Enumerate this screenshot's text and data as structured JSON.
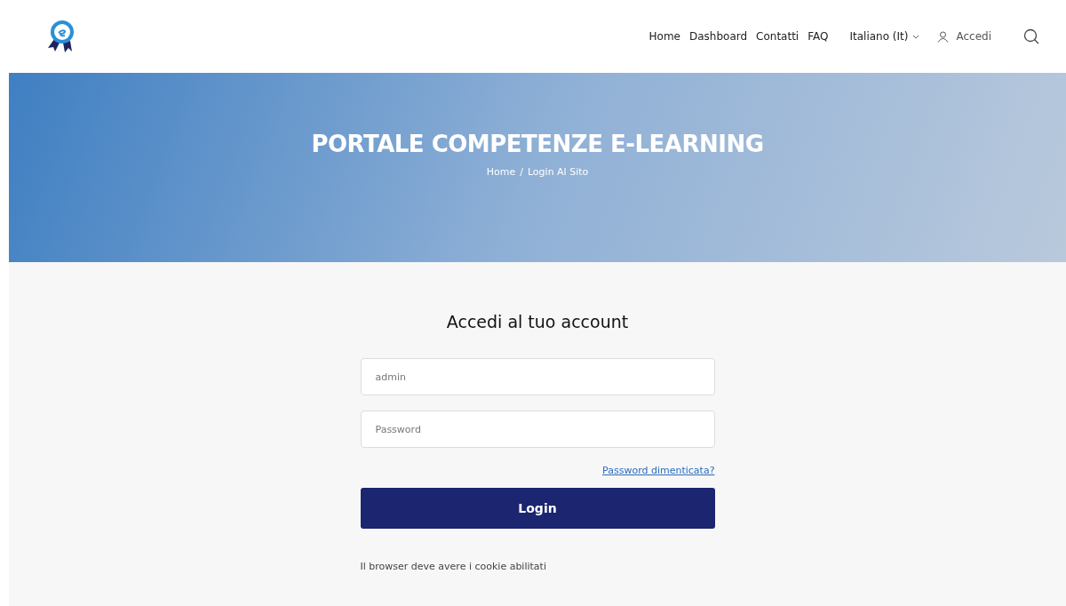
{
  "nav": {
    "links": [
      "Home",
      "Dashboard",
      "Contatti",
      "FAQ"
    ],
    "language": "Italiano (It)",
    "login": "Accedi"
  },
  "hero": {
    "title": "PORTALE COMPETENZE E-LEARNING",
    "breadcrumb": [
      "Home",
      "Login Al Sito"
    ],
    "separator": "/"
  },
  "login": {
    "heading": "Accedi al tuo account",
    "username": {
      "placeholder": "admin"
    },
    "password": {
      "placeholder": "Password"
    },
    "forgot": "Password dimenticata?",
    "button": "Login",
    "note": "Il browser deve avere i cookie abilitati"
  }
}
